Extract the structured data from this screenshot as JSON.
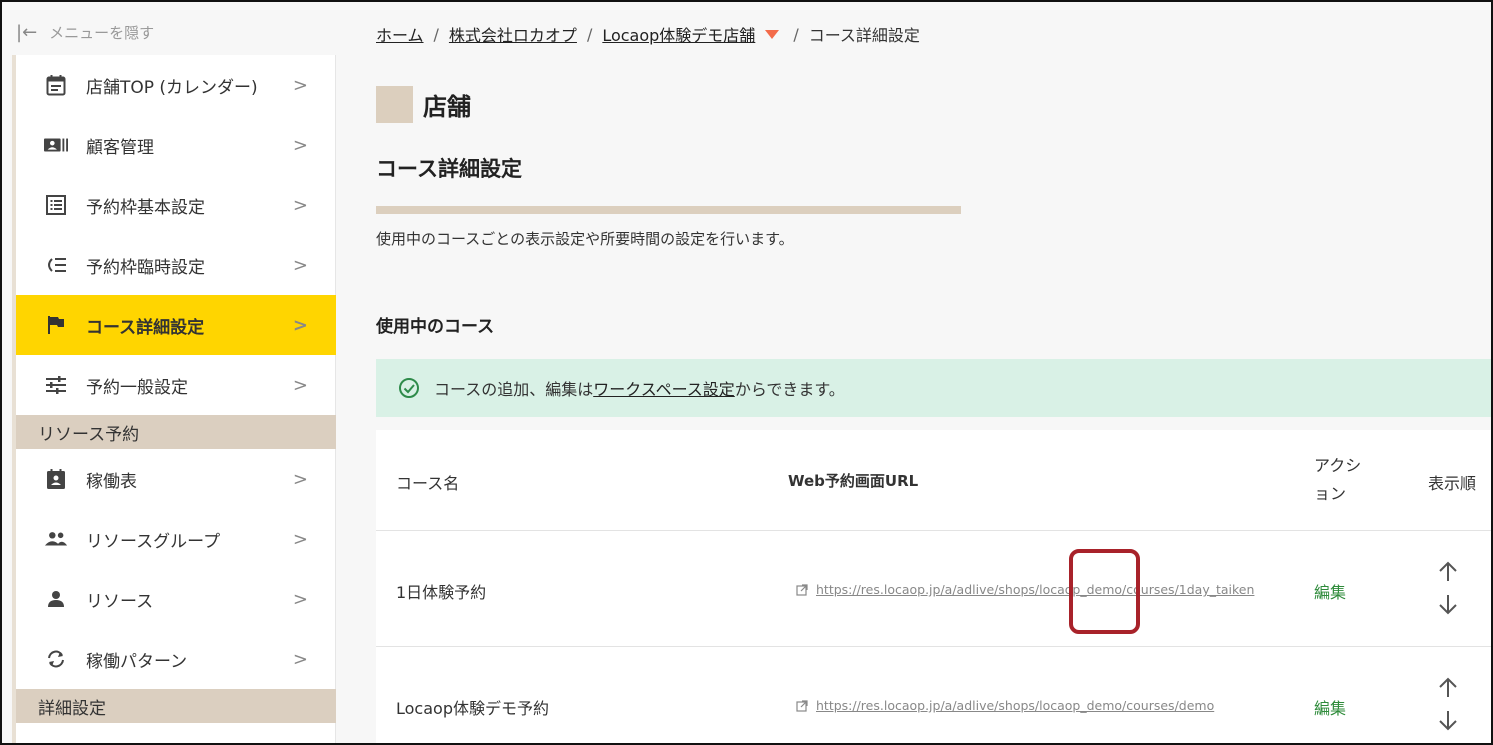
{
  "sidebar": {
    "hide_menu": "メニューを隠す",
    "items": [
      {
        "label": "店舗TOP (カレンダー)",
        "icon": "calendar-icon"
      },
      {
        "label": "顧客管理",
        "icon": "customer-card-icon"
      },
      {
        "label": "予約枠基本設定",
        "icon": "list-icon"
      },
      {
        "label": "予約枠臨時設定",
        "icon": "temporary-list-icon"
      },
      {
        "label": "コース詳細設定",
        "icon": "flag-icon",
        "active": true
      },
      {
        "label": "予約一般設定",
        "icon": "sliders-icon"
      }
    ],
    "section_resource": "リソース予約",
    "resource_items": [
      {
        "label": "稼働表",
        "icon": "schedule-icon"
      },
      {
        "label": "リソースグループ",
        "icon": "group-icon"
      },
      {
        "label": "リソース",
        "icon": "person-icon"
      },
      {
        "label": "稼働パターン",
        "icon": "sync-icon"
      }
    ],
    "section_detail": "詳細設定",
    "chevron": ">"
  },
  "breadcrumb": {
    "home": "ホーム",
    "company": "株式会社ロカオプ",
    "shop": "Locaop体験デモ店舗",
    "current": "コース詳細設定",
    "separator": "/"
  },
  "header": {
    "shop_title": "店舗",
    "page_title": "コース詳細設定",
    "description": "使用中のコースごとの表示設定や所要時間の設定を行います。"
  },
  "section_title": "使用中のコース",
  "notice": {
    "prefix": "コースの追加、編集は",
    "link": "ワークスペース設定",
    "suffix": "からできます。"
  },
  "table": {
    "headers": {
      "course": "コース名",
      "url": "Web予約画面URL",
      "action": "アクション",
      "order": "表示順"
    },
    "rows": [
      {
        "name": "1日体験予約",
        "url": "https://res.locaop.jp/a/adlive/shops/locaop_demo/courses/1day_taiken",
        "action": "編集"
      },
      {
        "name": "Locaop体験デモ予約",
        "url": "https://res.locaop.jp/a/adlive/shops/locaop_demo/courses/demo",
        "action": "編集"
      }
    ],
    "up_arrow": "↑",
    "down_arrow": "↓"
  },
  "colors": {
    "active_nav": "#ffd500",
    "section_head": "#dbcfc0",
    "notice_bg": "#d9f1e6",
    "edit_link": "#2e8b3a",
    "highlight_border": "#a8222a",
    "dropdown_triangle": "#f36b4a"
  }
}
